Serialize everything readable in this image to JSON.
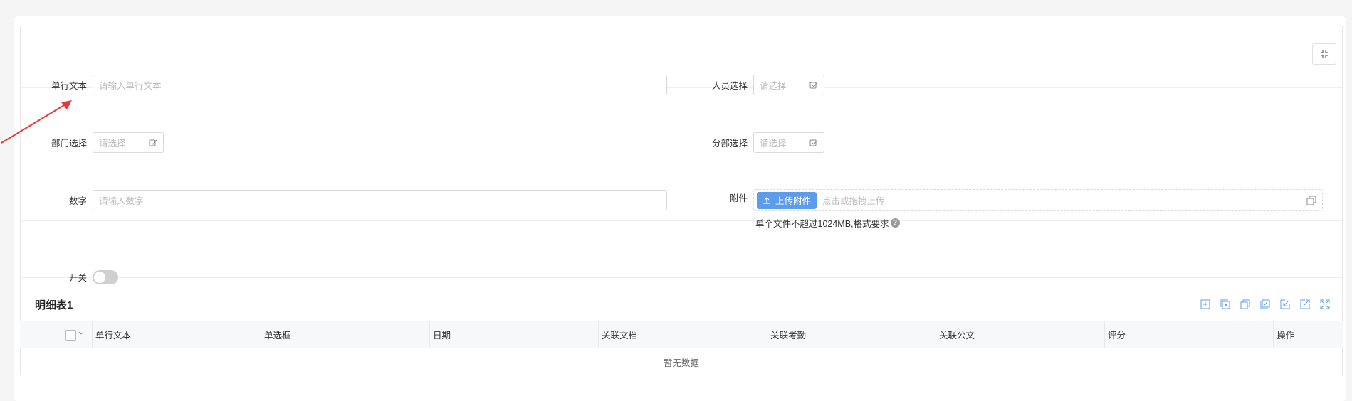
{
  "form": {
    "fields": {
      "single_text": {
        "label": "单行文本",
        "placeholder": "请输入单行文本"
      },
      "person_select": {
        "label": "人员选择",
        "placeholder": "请选择"
      },
      "dept_select": {
        "label": "部门选择",
        "placeholder": "请选择"
      },
      "subdept_select": {
        "label": "分部选择",
        "placeholder": "请选择"
      },
      "number": {
        "label": "数字",
        "placeholder": "请输入数字"
      },
      "attachment": {
        "label": "附件",
        "button": "上传附件",
        "hint": "点击或拖拽上传",
        "note": "单个文件不超过1024MB,格式要求",
        "help": "?"
      },
      "switch": {
        "label": "开关",
        "value": false
      }
    }
  },
  "detail_table": {
    "title": "明细表1",
    "columns": [
      "单行文本",
      "单选框",
      "日期",
      "关联文档",
      "关联考勤",
      "关联公文",
      "评分",
      "操作"
    ],
    "empty_text": "暂无数据",
    "toolbar_icons": [
      "add-row-icon",
      "delete-row-icon",
      "copy-row-icon",
      "edit-icon",
      "import-icon",
      "export-icon",
      "expand-icon"
    ]
  },
  "colors": {
    "accent": "#5d9cec",
    "icon": "#5d9cec",
    "annotation_arrow": "#e53935"
  }
}
